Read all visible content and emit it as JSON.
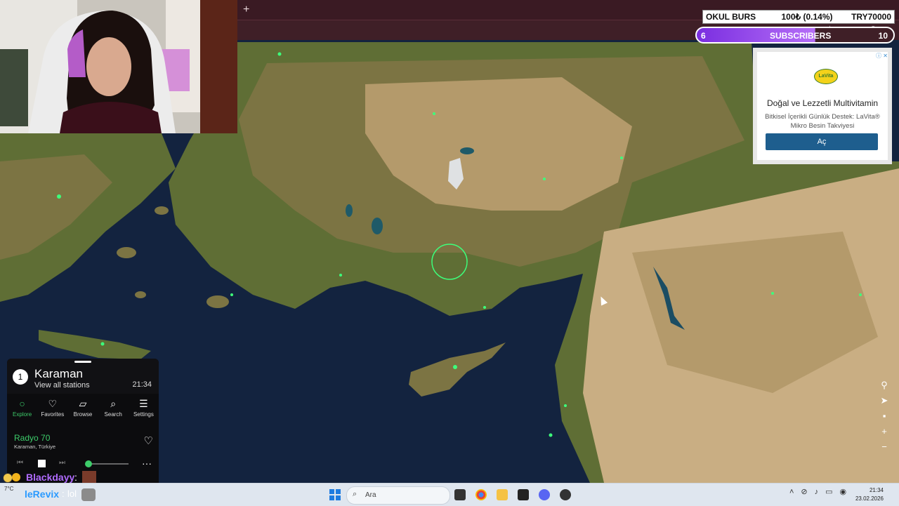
{
  "browser": {
    "new_tab_label": "+",
    "window_controls": "– ▢ ✕"
  },
  "ticker": {
    "name": "OKUL BURS",
    "value": "100₺ (0.14%)",
    "goal": "TRY70000"
  },
  "subscribers": {
    "current": "6",
    "label": "SUBSCRIBERS",
    "target": "10",
    "progress": 0.6
  },
  "ad": {
    "logo_text": "LaVita",
    "title": "Doğal ve Lezzetli Multivitamin",
    "description": "Bitkisel İçerikli Günlük Destek: LaVita® Mikro Besin Takviyesi",
    "button_label": "Aç",
    "adchoices": "ⓘ ✕"
  },
  "radio": {
    "count": "1",
    "city": "Karaman",
    "view_all": "View all stations",
    "time": "21:34",
    "nav": [
      {
        "label": "Explore",
        "icon": "explore-icon"
      },
      {
        "label": "Favorites",
        "icon": "heart-icon"
      },
      {
        "label": "Browse",
        "icon": "map-icon"
      },
      {
        "label": "Search",
        "icon": "search-icon"
      },
      {
        "label": "Settings",
        "icon": "menu-icon"
      }
    ],
    "station_name": "Radyo 70",
    "station_location": "Karaman, Türkiye",
    "more": "···"
  },
  "chat": [
    {
      "user": "Blackdayy",
      "separator": ":"
    },
    {
      "user": "leRevix",
      "separator": ":",
      "message": "lol"
    }
  ],
  "taskbar": {
    "weather": "7°C",
    "search_placeholder": "Ara",
    "time": "21:34",
    "date": "23.02.2026"
  },
  "colors": {
    "accent_green": "#3dcc6a",
    "station_dot": "#3dff7b",
    "ad_button": "#1e5e8e",
    "sub_purple": "#7a2ee0"
  }
}
